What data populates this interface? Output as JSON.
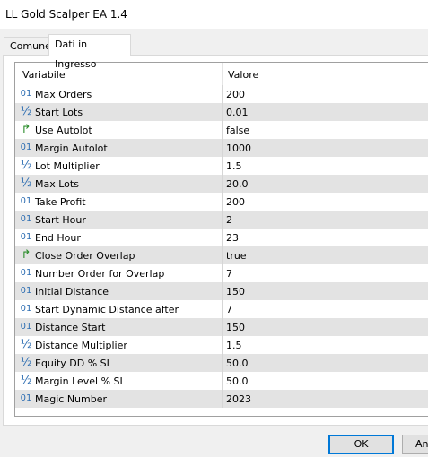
{
  "window": {
    "title": "LL Gold Scalper EA 1.4"
  },
  "tabs": [
    {
      "label": "Comune",
      "active": false
    },
    {
      "label": "Dati in Ingresso",
      "active": true
    }
  ],
  "table": {
    "headers": {
      "variable": "Variabile",
      "value": "Valore"
    },
    "rows": [
      {
        "icon": "int",
        "glyph": "01",
        "name": "Max Orders",
        "value": "200"
      },
      {
        "icon": "double",
        "glyph": "½",
        "name": "Start Lots",
        "value": "0.01"
      },
      {
        "icon": "bool",
        "glyph": "↱",
        "name": "Use Autolot",
        "value": "false"
      },
      {
        "icon": "int",
        "glyph": "01",
        "name": "Margin Autolot",
        "value": "1000"
      },
      {
        "icon": "double",
        "glyph": "½",
        "name": "Lot Multiplier",
        "value": "1.5"
      },
      {
        "icon": "double",
        "glyph": "½",
        "name": "Max Lots",
        "value": "20.0"
      },
      {
        "icon": "int",
        "glyph": "01",
        "name": "Take Profit",
        "value": "200"
      },
      {
        "icon": "int",
        "glyph": "01",
        "name": "Start Hour",
        "value": "2"
      },
      {
        "icon": "int",
        "glyph": "01",
        "name": "End Hour",
        "value": "23"
      },
      {
        "icon": "bool",
        "glyph": "↱",
        "name": "Close Order Overlap",
        "value": "true"
      },
      {
        "icon": "int",
        "glyph": "01",
        "name": "Number Order for Overlap",
        "value": "7"
      },
      {
        "icon": "int",
        "glyph": "01",
        "name": "Initial Distance",
        "value": "150"
      },
      {
        "icon": "int",
        "glyph": "01",
        "name": "Start Dynamic Distance after",
        "value": "7"
      },
      {
        "icon": "int",
        "glyph": "01",
        "name": "Distance Start",
        "value": "150"
      },
      {
        "icon": "double",
        "glyph": "½",
        "name": "Distance Multiplier",
        "value": "1.5"
      },
      {
        "icon": "double",
        "glyph": "½",
        "name": "Equity DD % SL",
        "value": "50.0"
      },
      {
        "icon": "double",
        "glyph": "½",
        "name": "Margin Level % SL",
        "value": "50.0"
      },
      {
        "icon": "int",
        "glyph": "01",
        "name": "Magic Number",
        "value": "2023"
      }
    ]
  },
  "buttons": {
    "ok": "OK",
    "cancel": "An"
  },
  "colors": {
    "accent": "#0078d7",
    "row_alt": "#e3e3e3",
    "int_icon": "#2f6fb3",
    "bool_icon": "#2a8c2a"
  }
}
